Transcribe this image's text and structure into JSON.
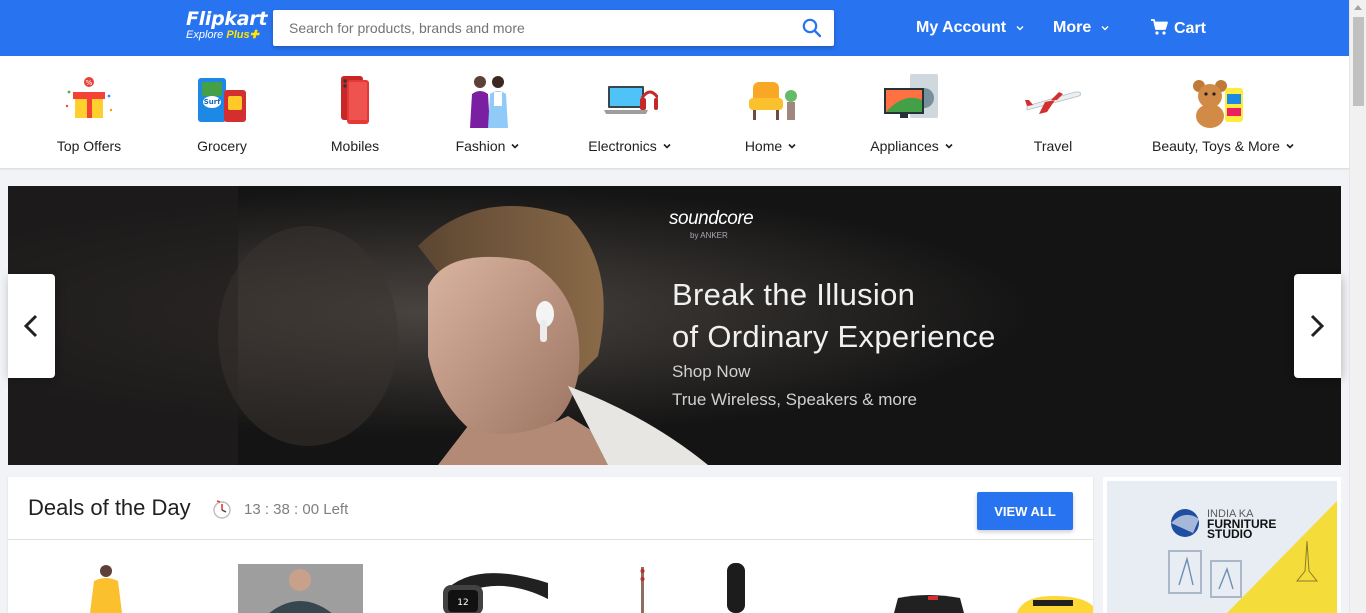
{
  "header": {
    "logo_text": "Flipkart",
    "logo_sub_text": "Explore",
    "logo_sub_plus": "Plus",
    "search_placeholder": "Search for products, brands and more",
    "my_account_label": "My Account",
    "more_label": "More",
    "cart_label": "Cart",
    "colors": {
      "brand_blue": "#2874f0",
      "brand_yellow": "#ffe500"
    }
  },
  "categories": [
    {
      "label": "Top Offers",
      "icon": "gift-box-icon",
      "has_dropdown": false
    },
    {
      "label": "Grocery",
      "icon": "grocery-pack-icon",
      "has_dropdown": false
    },
    {
      "label": "Mobiles",
      "icon": "smartphone-icon",
      "has_dropdown": false
    },
    {
      "label": "Fashion",
      "icon": "fashion-models-icon",
      "has_dropdown": true
    },
    {
      "label": "Electronics",
      "icon": "laptop-headphones-icon",
      "has_dropdown": true
    },
    {
      "label": "Home",
      "icon": "armchair-icon",
      "has_dropdown": true
    },
    {
      "label": "Appliances",
      "icon": "tv-washer-icon",
      "has_dropdown": true
    },
    {
      "label": "Travel",
      "icon": "airplane-icon",
      "has_dropdown": false
    },
    {
      "label": "Beauty, Toys & More",
      "icon": "teddy-bear-icon",
      "has_dropdown": true
    }
  ],
  "banner": {
    "brand": "soundcore",
    "brand_sub": "by ANKER",
    "headline_line1": "Break the Illusion",
    "headline_line2": "of Ordinary Experience",
    "cta": "Shop Now",
    "subtext": "True Wireless, Speakers & more"
  },
  "deals": {
    "title": "Deals of the Day",
    "timer_text": "13 : 38 : 00 Left",
    "view_all_label": "VIEW ALL",
    "products": [
      {
        "icon": "ethnic-dress-icon"
      },
      {
        "icon": "men-shirt-icon"
      },
      {
        "icon": "smartwatch-icon"
      },
      {
        "icon": "guitar-icon"
      },
      {
        "icon": "trimmer-icon"
      },
      {
        "icon": "speaker-icon"
      },
      {
        "icon": "yellow-gadget-icon"
      }
    ]
  },
  "ad": {
    "line1": "INDIA KA",
    "line2": "FURNITURE",
    "line3": "STUDIO"
  }
}
